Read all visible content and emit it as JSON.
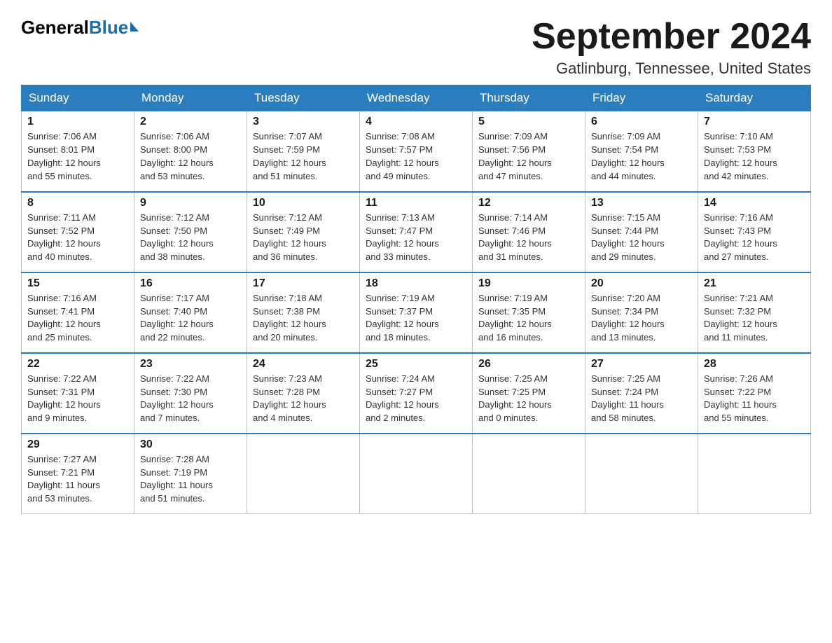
{
  "logo": {
    "general": "General",
    "blue": "Blue"
  },
  "title": {
    "month": "September 2024",
    "location": "Gatlinburg, Tennessee, United States"
  },
  "headers": [
    "Sunday",
    "Monday",
    "Tuesday",
    "Wednesday",
    "Thursday",
    "Friday",
    "Saturday"
  ],
  "weeks": [
    [
      {
        "day": "1",
        "sunrise": "7:06 AM",
        "sunset": "8:01 PM",
        "daylight": "12 hours and 55 minutes."
      },
      {
        "day": "2",
        "sunrise": "7:06 AM",
        "sunset": "8:00 PM",
        "daylight": "12 hours and 53 minutes."
      },
      {
        "day": "3",
        "sunrise": "7:07 AM",
        "sunset": "7:59 PM",
        "daylight": "12 hours and 51 minutes."
      },
      {
        "day": "4",
        "sunrise": "7:08 AM",
        "sunset": "7:57 PM",
        "daylight": "12 hours and 49 minutes."
      },
      {
        "day": "5",
        "sunrise": "7:09 AM",
        "sunset": "7:56 PM",
        "daylight": "12 hours and 47 minutes."
      },
      {
        "day": "6",
        "sunrise": "7:09 AM",
        "sunset": "7:54 PM",
        "daylight": "12 hours and 44 minutes."
      },
      {
        "day": "7",
        "sunrise": "7:10 AM",
        "sunset": "7:53 PM",
        "daylight": "12 hours and 42 minutes."
      }
    ],
    [
      {
        "day": "8",
        "sunrise": "7:11 AM",
        "sunset": "7:52 PM",
        "daylight": "12 hours and 40 minutes."
      },
      {
        "day": "9",
        "sunrise": "7:12 AM",
        "sunset": "7:50 PM",
        "daylight": "12 hours and 38 minutes."
      },
      {
        "day": "10",
        "sunrise": "7:12 AM",
        "sunset": "7:49 PM",
        "daylight": "12 hours and 36 minutes."
      },
      {
        "day": "11",
        "sunrise": "7:13 AM",
        "sunset": "7:47 PM",
        "daylight": "12 hours and 33 minutes."
      },
      {
        "day": "12",
        "sunrise": "7:14 AM",
        "sunset": "7:46 PM",
        "daylight": "12 hours and 31 minutes."
      },
      {
        "day": "13",
        "sunrise": "7:15 AM",
        "sunset": "7:44 PM",
        "daylight": "12 hours and 29 minutes."
      },
      {
        "day": "14",
        "sunrise": "7:16 AM",
        "sunset": "7:43 PM",
        "daylight": "12 hours and 27 minutes."
      }
    ],
    [
      {
        "day": "15",
        "sunrise": "7:16 AM",
        "sunset": "7:41 PM",
        "daylight": "12 hours and 25 minutes."
      },
      {
        "day": "16",
        "sunrise": "7:17 AM",
        "sunset": "7:40 PM",
        "daylight": "12 hours and 22 minutes."
      },
      {
        "day": "17",
        "sunrise": "7:18 AM",
        "sunset": "7:38 PM",
        "daylight": "12 hours and 20 minutes."
      },
      {
        "day": "18",
        "sunrise": "7:19 AM",
        "sunset": "7:37 PM",
        "daylight": "12 hours and 18 minutes."
      },
      {
        "day": "19",
        "sunrise": "7:19 AM",
        "sunset": "7:35 PM",
        "daylight": "12 hours and 16 minutes."
      },
      {
        "day": "20",
        "sunrise": "7:20 AM",
        "sunset": "7:34 PM",
        "daylight": "12 hours and 13 minutes."
      },
      {
        "day": "21",
        "sunrise": "7:21 AM",
        "sunset": "7:32 PM",
        "daylight": "12 hours and 11 minutes."
      }
    ],
    [
      {
        "day": "22",
        "sunrise": "7:22 AM",
        "sunset": "7:31 PM",
        "daylight": "12 hours and 9 minutes."
      },
      {
        "day": "23",
        "sunrise": "7:22 AM",
        "sunset": "7:30 PM",
        "daylight": "12 hours and 7 minutes."
      },
      {
        "day": "24",
        "sunrise": "7:23 AM",
        "sunset": "7:28 PM",
        "daylight": "12 hours and 4 minutes."
      },
      {
        "day": "25",
        "sunrise": "7:24 AM",
        "sunset": "7:27 PM",
        "daylight": "12 hours and 2 minutes."
      },
      {
        "day": "26",
        "sunrise": "7:25 AM",
        "sunset": "7:25 PM",
        "daylight": "12 hours and 0 minutes."
      },
      {
        "day": "27",
        "sunrise": "7:25 AM",
        "sunset": "7:24 PM",
        "daylight": "11 hours and 58 minutes."
      },
      {
        "day": "28",
        "sunrise": "7:26 AM",
        "sunset": "7:22 PM",
        "daylight": "11 hours and 55 minutes."
      }
    ],
    [
      {
        "day": "29",
        "sunrise": "7:27 AM",
        "sunset": "7:21 PM",
        "daylight": "11 hours and 53 minutes."
      },
      {
        "day": "30",
        "sunrise": "7:28 AM",
        "sunset": "7:19 PM",
        "daylight": "11 hours and 51 minutes."
      },
      null,
      null,
      null,
      null,
      null
    ]
  ],
  "labels": {
    "sunrise": "Sunrise:",
    "sunset": "Sunset:",
    "daylight": "Daylight:"
  }
}
